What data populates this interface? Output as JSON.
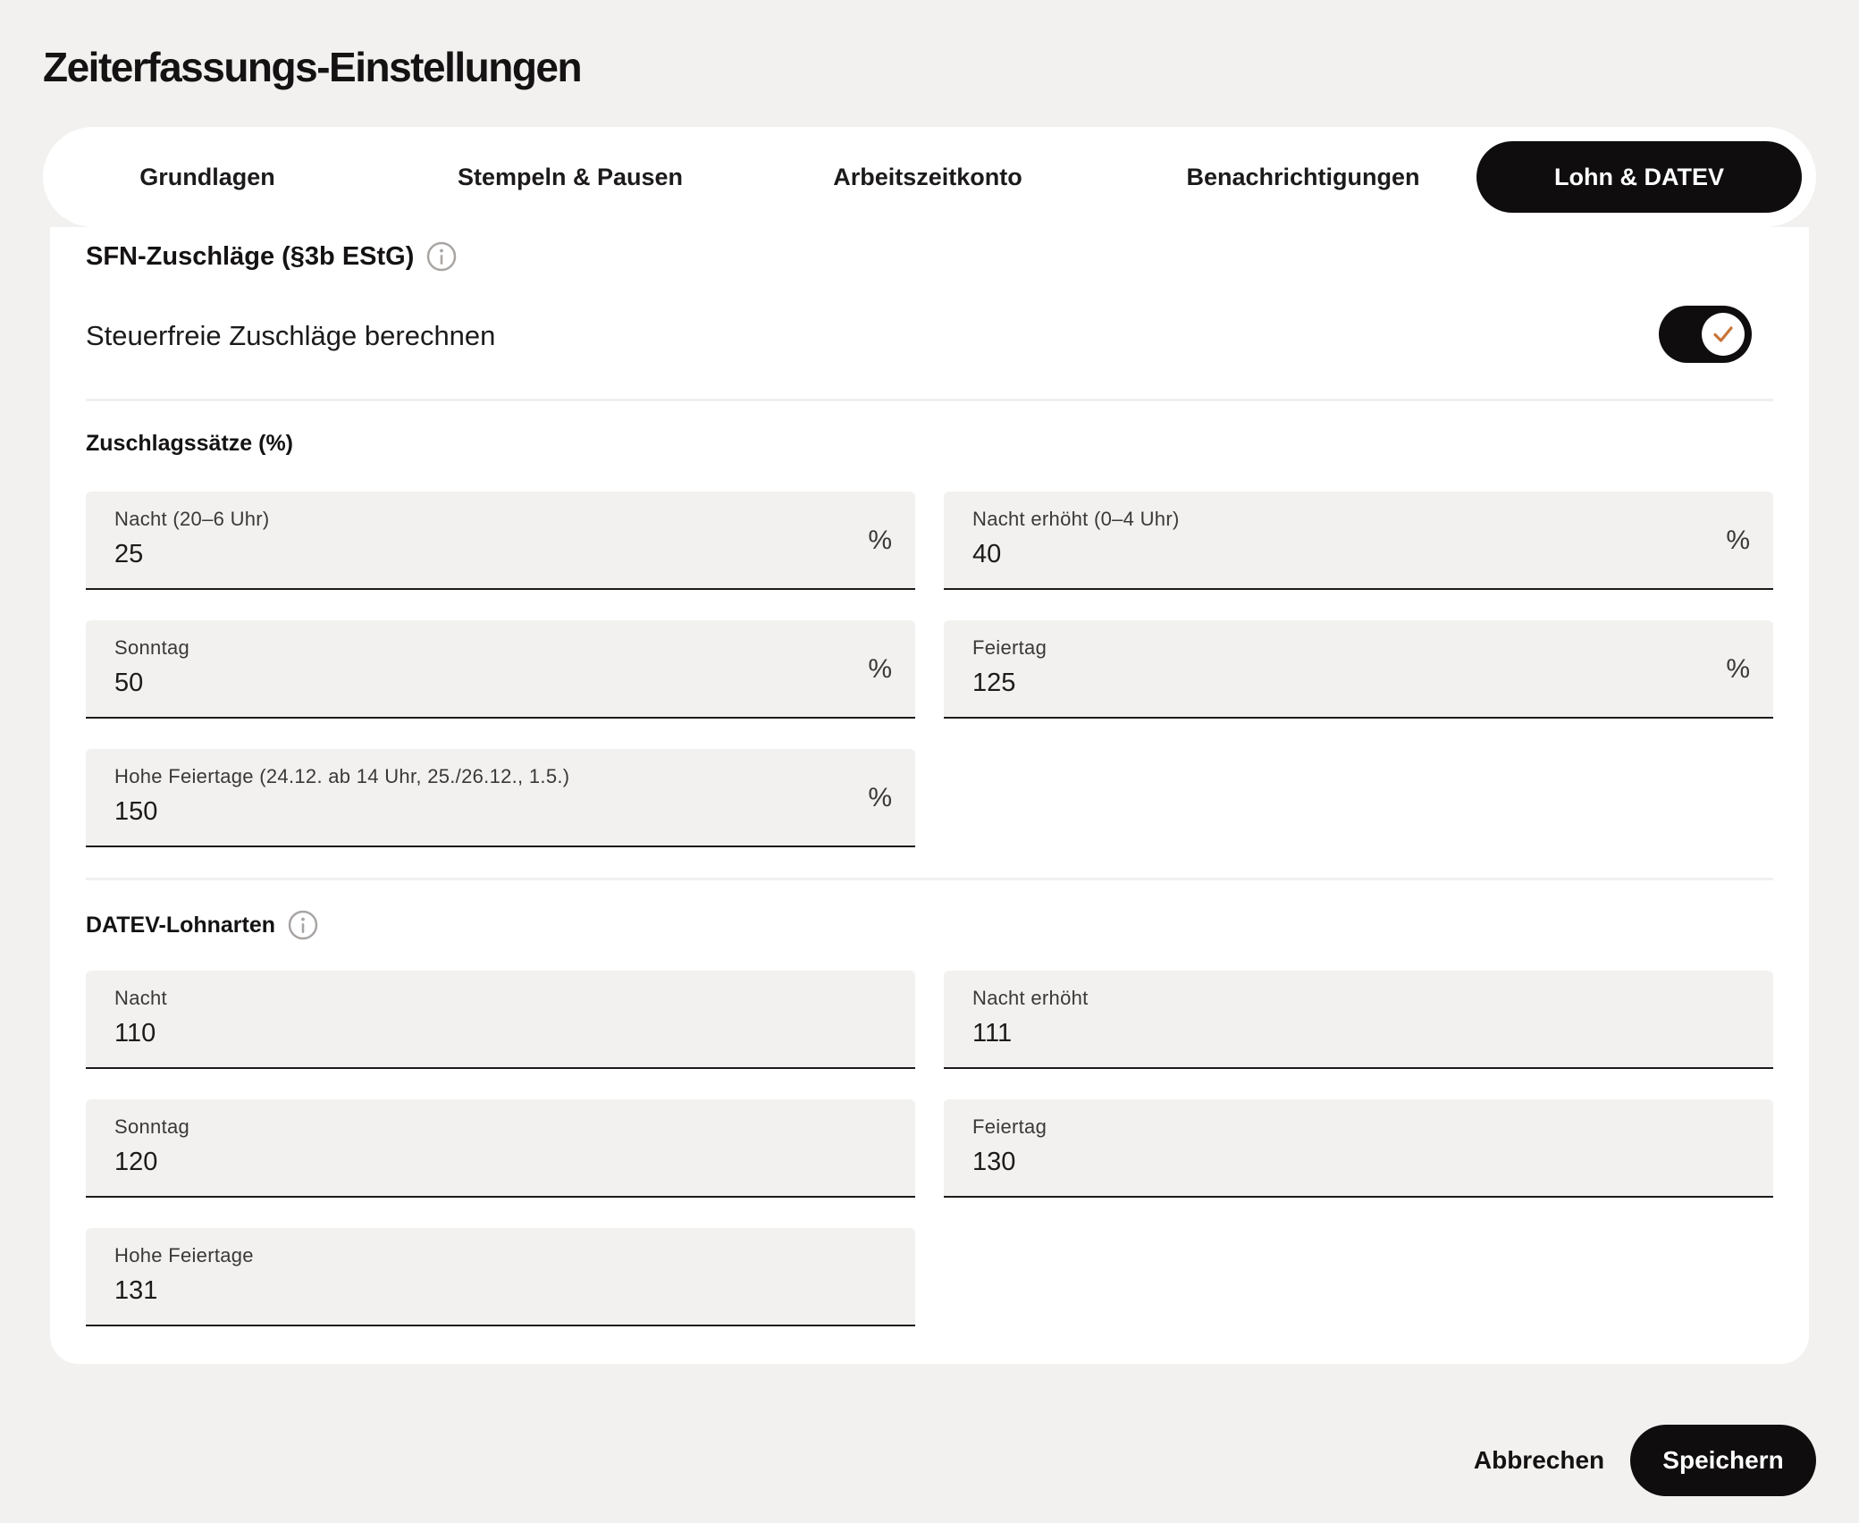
{
  "dialog": {
    "title": "Zeiterfassungs-Einstellungen"
  },
  "tabs": [
    {
      "label": "Grundlagen",
      "active": false
    },
    {
      "label": "Stempeln & Pausen",
      "active": false
    },
    {
      "label": "Arbeitszeitkonto",
      "active": false
    },
    {
      "label": "Benachrichtigungen",
      "active": false
    },
    {
      "label": "Lohn & DATEV",
      "active": true
    }
  ],
  "sfn": {
    "title": "SFN-Zuschläge (§3b EStG)",
    "info_icon": "info-circle-icon",
    "toggle_label": "Steuerfreie Zuschläge berechnen",
    "toggle_on": true,
    "toggle_icon": "check-icon",
    "check_color": "#c8743a"
  },
  "rates": {
    "title": "Zuschlagssätze (%)",
    "fields": [
      {
        "label": "Nacht (20–6 Uhr)",
        "value": "25",
        "unit": "%"
      },
      {
        "label": "Nacht erhöht (0–4 Uhr)",
        "value": "40",
        "unit": "%"
      },
      {
        "label": "Sonntag",
        "value": "50",
        "unit": "%"
      },
      {
        "label": "Feiertag",
        "value": "125",
        "unit": "%"
      },
      {
        "label": "Hohe Feiertage (24.12. ab 14 Uhr, 25./26.12., 1.5.)",
        "value": "150",
        "unit": "%"
      }
    ]
  },
  "datev": {
    "title": "DATEV-Lohnarten",
    "info_icon": "info-circle-icon",
    "fields": [
      {
        "label": "Nacht",
        "value": "110"
      },
      {
        "label": "Nacht erhöht",
        "value": "111"
      },
      {
        "label": "Sonntag",
        "value": "120"
      },
      {
        "label": "Feiertag",
        "value": "130"
      },
      {
        "label": "Hohe Feiertage",
        "value": "131"
      }
    ]
  },
  "footer": {
    "cancel_label": "Abbrechen",
    "save_label": "Speichern"
  },
  "colors": {
    "background": "#f2f1ef",
    "panel": "#ffffff",
    "primary": "#0f0d0d",
    "accent": "#c8743a"
  }
}
